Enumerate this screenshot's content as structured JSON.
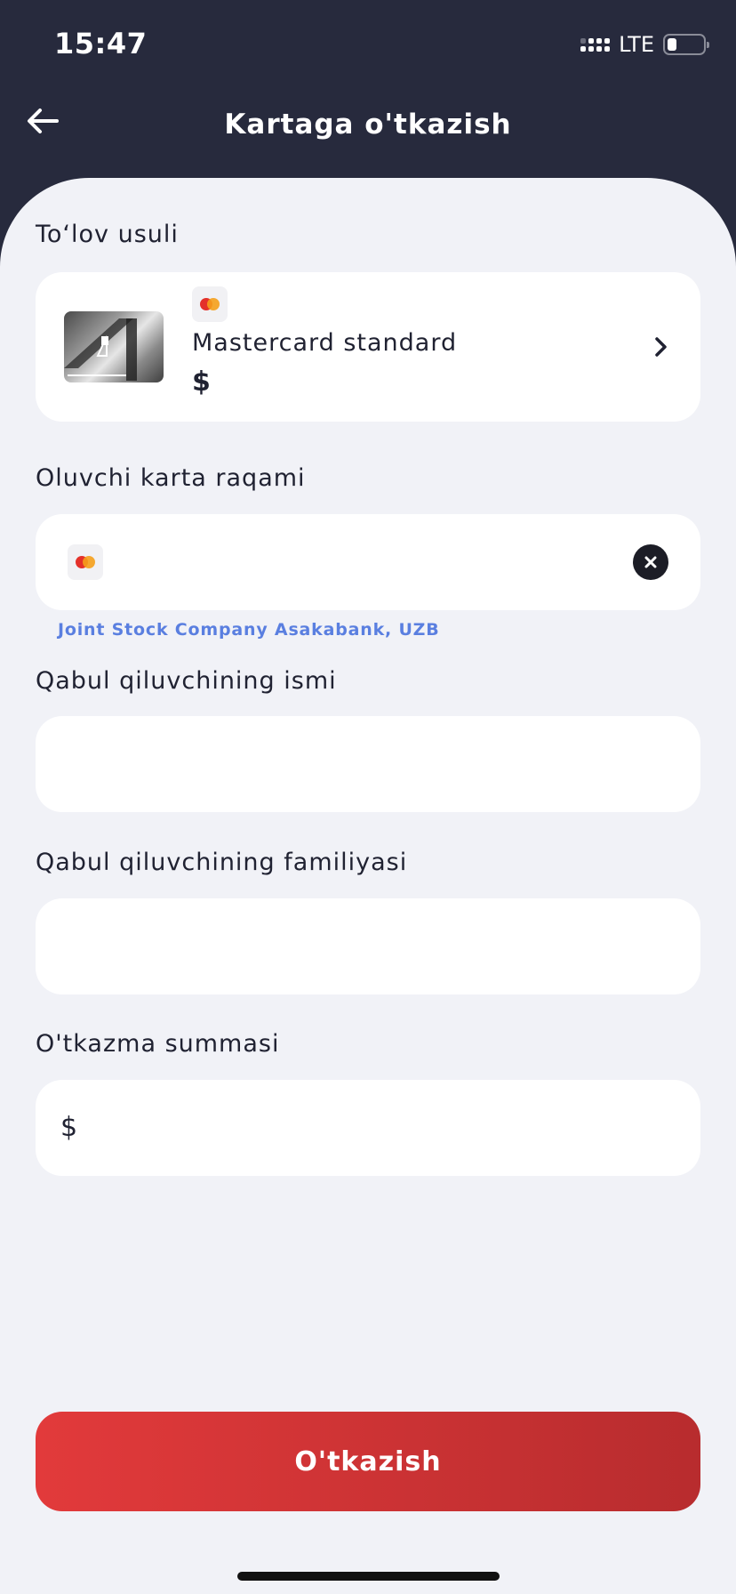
{
  "status_bar": {
    "time": "15:47",
    "network": "LTE",
    "icons": [
      "signal-icon",
      "battery-icon"
    ]
  },
  "header": {
    "title": "Kartaga o'tkazish",
    "back_icon": "arrow-left-icon"
  },
  "payment_method": {
    "label": "To‘lov usuli",
    "card_name": "Mastercard standard",
    "currency": "$",
    "brand_icon": "mastercard-icon",
    "chevron_icon": "chevron-right-icon"
  },
  "recipient_card": {
    "label": "Oluvchi karta raqami",
    "value": "",
    "clear_icon": "close-icon",
    "bank_hint": "Joint Stock Company Asakabank, UZB"
  },
  "recipient_first_name": {
    "label": "Qabul qiluvchining ismi",
    "value": ""
  },
  "recipient_last_name": {
    "label": "Qabul qiluvchining familiyasi",
    "value": ""
  },
  "amount": {
    "label": "O'tkazma summasi",
    "currency": "$",
    "value": ""
  },
  "submit": {
    "label": "O'tkazish"
  },
  "colors": {
    "header_bg": "#272a3d",
    "sheet_bg": "#f1f2f7",
    "accent_red": "#e23a3b",
    "hint_blue": "#5a7fe0"
  }
}
